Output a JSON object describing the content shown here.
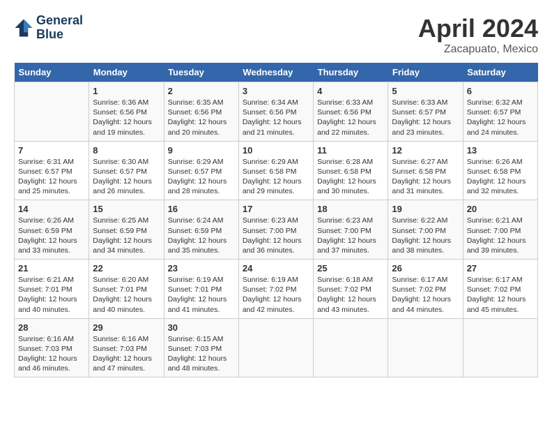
{
  "header": {
    "logo_line1": "General",
    "logo_line2": "Blue",
    "month": "April 2024",
    "location": "Zacapuato, Mexico"
  },
  "weekdays": [
    "Sunday",
    "Monday",
    "Tuesday",
    "Wednesday",
    "Thursday",
    "Friday",
    "Saturday"
  ],
  "weeks": [
    [
      {
        "day": "",
        "info": ""
      },
      {
        "day": "1",
        "info": "Sunrise: 6:36 AM\nSunset: 6:56 PM\nDaylight: 12 hours\nand 19 minutes."
      },
      {
        "day": "2",
        "info": "Sunrise: 6:35 AM\nSunset: 6:56 PM\nDaylight: 12 hours\nand 20 minutes."
      },
      {
        "day": "3",
        "info": "Sunrise: 6:34 AM\nSunset: 6:56 PM\nDaylight: 12 hours\nand 21 minutes."
      },
      {
        "day": "4",
        "info": "Sunrise: 6:33 AM\nSunset: 6:56 PM\nDaylight: 12 hours\nand 22 minutes."
      },
      {
        "day": "5",
        "info": "Sunrise: 6:33 AM\nSunset: 6:57 PM\nDaylight: 12 hours\nand 23 minutes."
      },
      {
        "day": "6",
        "info": "Sunrise: 6:32 AM\nSunset: 6:57 PM\nDaylight: 12 hours\nand 24 minutes."
      }
    ],
    [
      {
        "day": "7",
        "info": "Sunrise: 6:31 AM\nSunset: 6:57 PM\nDaylight: 12 hours\nand 25 minutes."
      },
      {
        "day": "8",
        "info": "Sunrise: 6:30 AM\nSunset: 6:57 PM\nDaylight: 12 hours\nand 26 minutes."
      },
      {
        "day": "9",
        "info": "Sunrise: 6:29 AM\nSunset: 6:57 PM\nDaylight: 12 hours\nand 28 minutes."
      },
      {
        "day": "10",
        "info": "Sunrise: 6:29 AM\nSunset: 6:58 PM\nDaylight: 12 hours\nand 29 minutes."
      },
      {
        "day": "11",
        "info": "Sunrise: 6:28 AM\nSunset: 6:58 PM\nDaylight: 12 hours\nand 30 minutes."
      },
      {
        "day": "12",
        "info": "Sunrise: 6:27 AM\nSunset: 6:58 PM\nDaylight: 12 hours\nand 31 minutes."
      },
      {
        "day": "13",
        "info": "Sunrise: 6:26 AM\nSunset: 6:58 PM\nDaylight: 12 hours\nand 32 minutes."
      }
    ],
    [
      {
        "day": "14",
        "info": "Sunrise: 6:26 AM\nSunset: 6:59 PM\nDaylight: 12 hours\nand 33 minutes."
      },
      {
        "day": "15",
        "info": "Sunrise: 6:25 AM\nSunset: 6:59 PM\nDaylight: 12 hours\nand 34 minutes."
      },
      {
        "day": "16",
        "info": "Sunrise: 6:24 AM\nSunset: 6:59 PM\nDaylight: 12 hours\nand 35 minutes."
      },
      {
        "day": "17",
        "info": "Sunrise: 6:23 AM\nSunset: 7:00 PM\nDaylight: 12 hours\nand 36 minutes."
      },
      {
        "day": "18",
        "info": "Sunrise: 6:23 AM\nSunset: 7:00 PM\nDaylight: 12 hours\nand 37 minutes."
      },
      {
        "day": "19",
        "info": "Sunrise: 6:22 AM\nSunset: 7:00 PM\nDaylight: 12 hours\nand 38 minutes."
      },
      {
        "day": "20",
        "info": "Sunrise: 6:21 AM\nSunset: 7:00 PM\nDaylight: 12 hours\nand 39 minutes."
      }
    ],
    [
      {
        "day": "21",
        "info": "Sunrise: 6:21 AM\nSunset: 7:01 PM\nDaylight: 12 hours\nand 40 minutes."
      },
      {
        "day": "22",
        "info": "Sunrise: 6:20 AM\nSunset: 7:01 PM\nDaylight: 12 hours\nand 40 minutes."
      },
      {
        "day": "23",
        "info": "Sunrise: 6:19 AM\nSunset: 7:01 PM\nDaylight: 12 hours\nand 41 minutes."
      },
      {
        "day": "24",
        "info": "Sunrise: 6:19 AM\nSunset: 7:02 PM\nDaylight: 12 hours\nand 42 minutes."
      },
      {
        "day": "25",
        "info": "Sunrise: 6:18 AM\nSunset: 7:02 PM\nDaylight: 12 hours\nand 43 minutes."
      },
      {
        "day": "26",
        "info": "Sunrise: 6:17 AM\nSunset: 7:02 PM\nDaylight: 12 hours\nand 44 minutes."
      },
      {
        "day": "27",
        "info": "Sunrise: 6:17 AM\nSunset: 7:02 PM\nDaylight: 12 hours\nand 45 minutes."
      }
    ],
    [
      {
        "day": "28",
        "info": "Sunrise: 6:16 AM\nSunset: 7:03 PM\nDaylight: 12 hours\nand 46 minutes."
      },
      {
        "day": "29",
        "info": "Sunrise: 6:16 AM\nSunset: 7:03 PM\nDaylight: 12 hours\nand 47 minutes."
      },
      {
        "day": "30",
        "info": "Sunrise: 6:15 AM\nSunset: 7:03 PM\nDaylight: 12 hours\nand 48 minutes."
      },
      {
        "day": "",
        "info": ""
      },
      {
        "day": "",
        "info": ""
      },
      {
        "day": "",
        "info": ""
      },
      {
        "day": "",
        "info": ""
      }
    ]
  ]
}
